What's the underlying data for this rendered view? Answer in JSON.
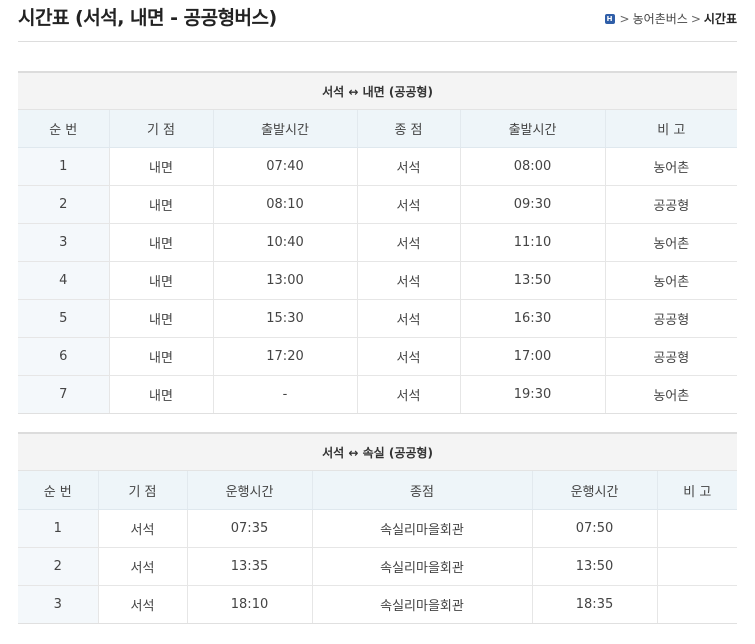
{
  "page": {
    "title": "시간표 (서석, 내면 - 공공형버스)",
    "breadcrumb": {
      "home_icon": "home-icon",
      "parent": "농어촌버스",
      "current": "시간표"
    }
  },
  "table1": {
    "caption": "서석 ↔ 내면 (공공형)",
    "headers": [
      "순 번",
      "기 점",
      "출발시간",
      "종 점",
      "출발시간",
      "비 고"
    ],
    "rows": [
      [
        "1",
        "내면",
        "07:40",
        "서석",
        "08:00",
        "농어촌"
      ],
      [
        "2",
        "내면",
        "08:10",
        "서석",
        "09:30",
        "공공형"
      ],
      [
        "3",
        "내면",
        "10:40",
        "서석",
        "11:10",
        "농어촌"
      ],
      [
        "4",
        "내면",
        "13:00",
        "서석",
        "13:50",
        "농어촌"
      ],
      [
        "5",
        "내면",
        "15:30",
        "서석",
        "16:30",
        "공공형"
      ],
      [
        "6",
        "내면",
        "17:20",
        "서석",
        "17:00",
        "공공형"
      ],
      [
        "7",
        "내면",
        "-",
        "서석",
        "19:30",
        "농어촌"
      ]
    ]
  },
  "table2": {
    "caption": "서석 ↔ 속실 (공공형)",
    "headers": [
      "순 번",
      "기 점",
      "운행시간",
      "종점",
      "운행시간",
      "비 고"
    ],
    "rows": [
      [
        "1",
        "서석",
        "07:35",
        "속실리마을회관",
        "07:50",
        ""
      ],
      [
        "2",
        "서석",
        "13:35",
        "속실리마을회관",
        "13:50",
        ""
      ],
      [
        "3",
        "서석",
        "18:10",
        "속실리마을회관",
        "18:35",
        ""
      ]
    ]
  }
}
